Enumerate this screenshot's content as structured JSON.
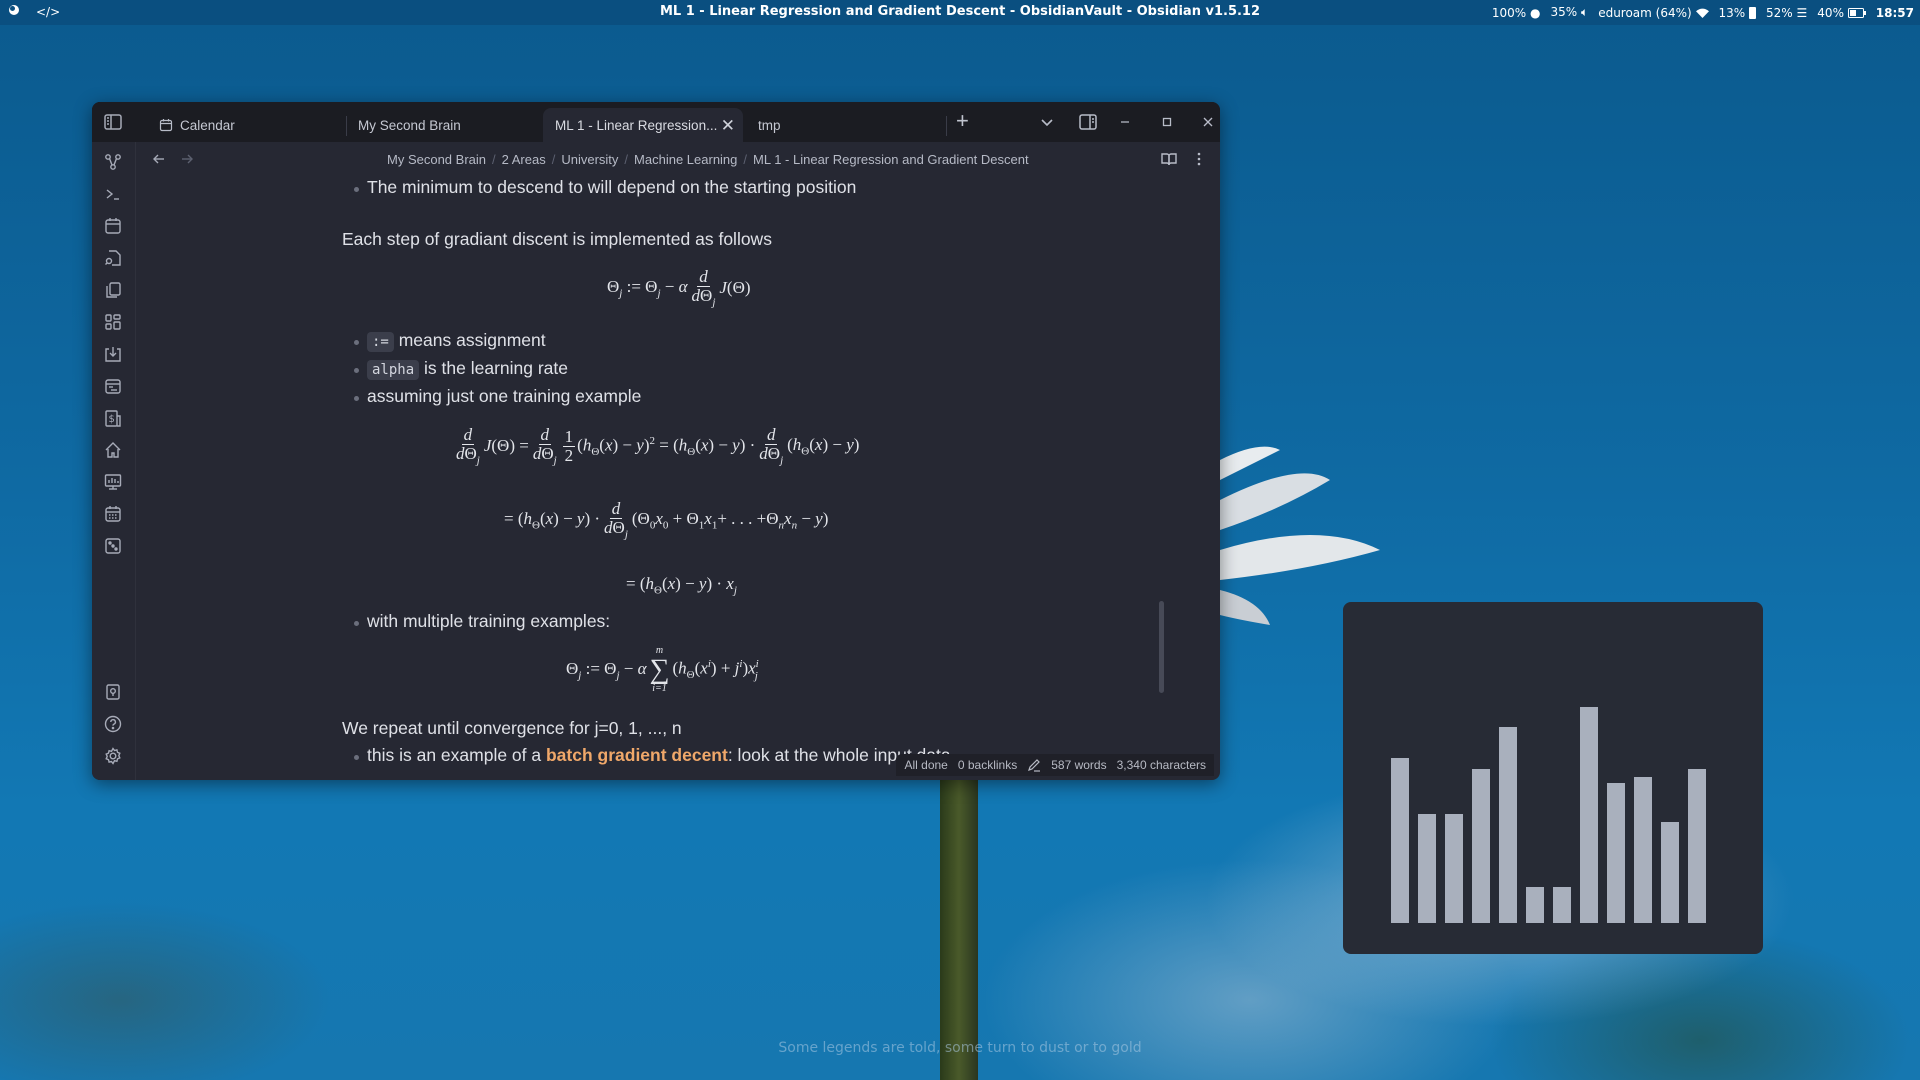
{
  "topbar": {
    "window_title": "ML 1 - Linear Regression and Gradient Descent - ObsidianVault - Obsidian v1.5.12",
    "left_icons": [
      "app-menu-icon",
      "code-icon"
    ],
    "status": {
      "brightness": "100%",
      "volume": "35%",
      "network": "eduroam (64%)",
      "cpu": "13%",
      "memory": "52%",
      "battery": "40%",
      "clock": "18:57"
    }
  },
  "window": {
    "tabs": [
      {
        "label": "Calendar",
        "icon": "calendar-icon",
        "active": false
      },
      {
        "label": "My Second Brain",
        "active": false
      },
      {
        "label": "ML 1 - Linear Regression...",
        "active": true,
        "close": "✕"
      },
      {
        "label": "tmp",
        "active": false
      }
    ],
    "new_tab": "+",
    "breadcrumb": [
      "My Second Brain",
      "2 Areas",
      "University",
      "Machine Learning",
      "ML 1 - Linear Regression and Gradient Descent"
    ],
    "ribbon_icons": [
      "graph-icon",
      "terminal-icon",
      "calendar-icon",
      "file-search-icon",
      "copy-icon",
      "dashboard-icon",
      "import-icon",
      "daily-note-icon",
      "budget-icon",
      "home-icon",
      "presentation-icon",
      "calendar-grid-icon",
      "dice-icon"
    ],
    "ribbon_bottom_icons": [
      "vault-icon",
      "help-icon",
      "settings-icon"
    ],
    "content": {
      "bullet_min": "The minimum to descend to will depend on the starting position",
      "para_step": "Each step of gradiant discent is implemented as follows",
      "bullet_assign_code": ":=",
      "bullet_assign_text": "means assignment",
      "bullet_alpha_code": "alpha",
      "bullet_alpha_text": "is the learning rate",
      "bullet_one": "assuming just one training example",
      "bullet_multi": "with multiple training examples:",
      "para_repeat": "We repeat until convergence for j=0, 1, ..., n",
      "bullet_batch_pre": "this is an example of a ",
      "bullet_batch_hl": "batch gradient decent",
      "bullet_batch_post": ": look at the whole input data"
    },
    "status_bar": {
      "sync": "All done",
      "backlinks": "0 backlinks",
      "words": "587 words",
      "characters": "3,340 characters"
    }
  },
  "visualizer": {
    "levels": [
      0.59,
      0.39,
      0.39,
      0.55,
      0.7,
      0.13,
      0.13,
      0.77,
      0.5,
      0.52,
      0.36,
      0.55
    ]
  },
  "motd": "Some legends are told, some turn to dust or to gold"
}
